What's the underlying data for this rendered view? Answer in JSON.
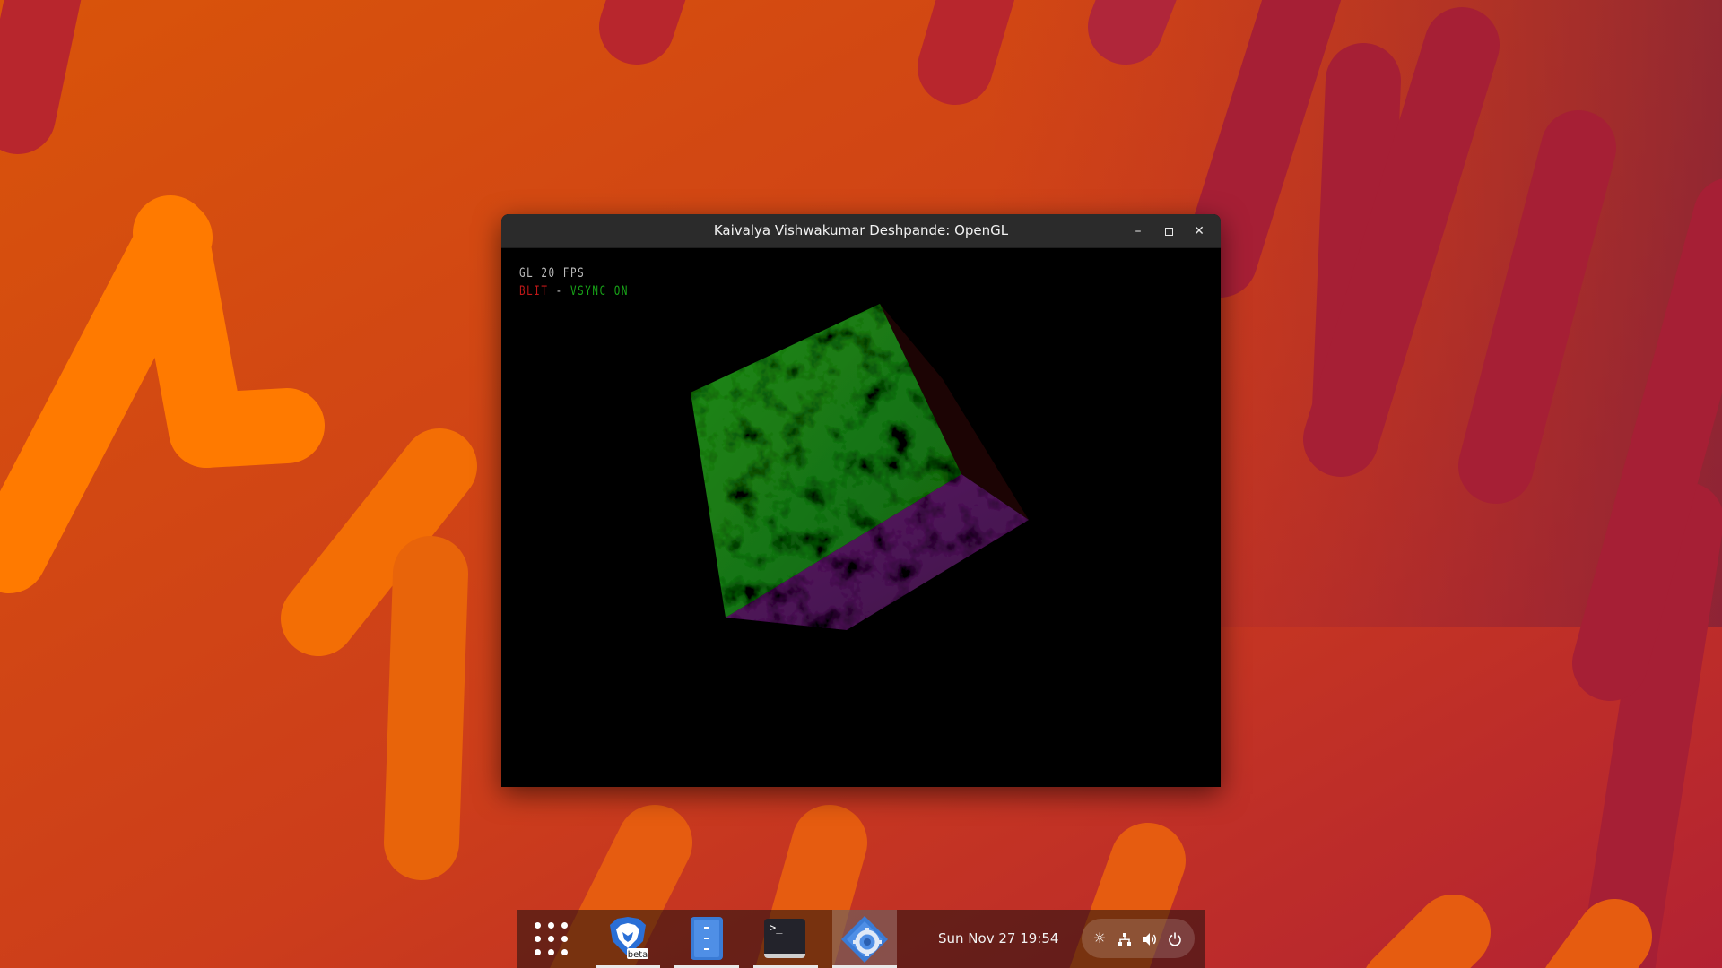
{
  "window": {
    "title": "Kaivalya Vishwakumar Deshpande: OpenGL",
    "controls": {
      "minimize": "–",
      "maximize": "▫",
      "close": "✕"
    }
  },
  "hud": {
    "fps_line": "GL 20 FPS",
    "blit": "BLIT",
    "separator": " - ",
    "vsync": "VSYNC ON"
  },
  "scene": {
    "cube_faces": [
      {
        "face": "front",
        "color": "#1a7a14"
      },
      {
        "face": "bottom",
        "color": "#5a1a62"
      },
      {
        "face": "right",
        "color": "#1c0404"
      }
    ]
  },
  "taskbar": {
    "apps": [
      {
        "icon": "apps-grid-icon",
        "running": false
      },
      {
        "icon": "brave-beta-icon",
        "badge": "beta",
        "running": true
      },
      {
        "icon": "file-manager-icon",
        "running": true
      },
      {
        "icon": "terminal-icon",
        "prompt": ">_",
        "running": true
      },
      {
        "icon": "opengl-app-icon",
        "running": true,
        "active": true
      }
    ],
    "clock": "Sun Nov 27  19:54",
    "tray": [
      "brightness-icon",
      "network-icon",
      "volume-icon",
      "power-icon"
    ]
  },
  "colors": {
    "accent": "#e8e8e8",
    "hud_red": "#c01818",
    "hud_green": "#18a318"
  }
}
